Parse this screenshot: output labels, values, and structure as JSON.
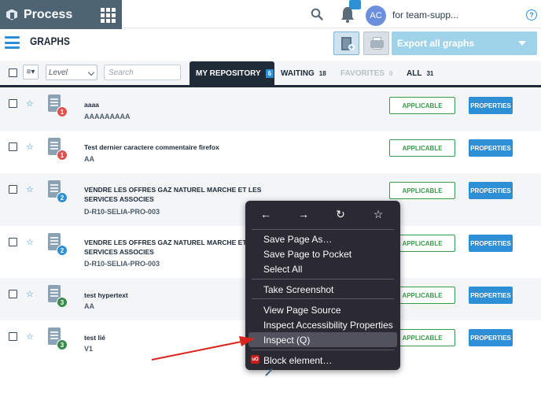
{
  "app": {
    "name": "Process",
    "team": "for team-supp...",
    "avatar_initials": "AC",
    "help": "?"
  },
  "page": {
    "title": "GRAPHS"
  },
  "actions": {
    "export_label": "Export all graphs"
  },
  "toolbar": {
    "level_label": "Level",
    "search_placeholder": "Search",
    "sort_glyph": "≡▾"
  },
  "tabs": [
    {
      "label": "MY REPOSITORY",
      "count": "6",
      "active": true
    },
    {
      "label": "WAITING",
      "count": "18"
    },
    {
      "label": "FAVORITES",
      "count": "0",
      "disabled": true
    },
    {
      "label": "ALL",
      "count": "31"
    }
  ],
  "rows": [
    {
      "title": "aaaa",
      "subtitle": "AAAAAAAAA",
      "level": "1",
      "level_color": "#e05252",
      "applicable": "APPLICABLE",
      "properties": "PROPERTIES"
    },
    {
      "title": "Test dernier caractere commentaire firefox",
      "subtitle": "AA",
      "level": "1",
      "level_color": "#e05252",
      "applicable": "APPLICABLE",
      "properties": "PROPERTIES"
    },
    {
      "title": "VENDRE LES OFFRES GAZ NATUREL MARCHE ET LES SERVICES ASSOCIES",
      "subtitle": "D-R10-SELIA-PRO-003",
      "level": "2",
      "level_color": "#2d8fd6",
      "applicable": "APPLICABLE",
      "properties": "PROPERTIES"
    },
    {
      "title": "VENDRE LES OFFRES GAZ NATUREL MARCHE ET LES SERVICES ASSOCIES",
      "subtitle": "D-R10-SELIA-PRO-003",
      "level": "2",
      "level_color": "#2d8fd6",
      "applicable": "APPLICABLE",
      "properties": "PROPERTIES"
    },
    {
      "title": "test hypertext",
      "subtitle": "AA",
      "level": "3",
      "level_color": "#3a8a4a",
      "applicable": "APPLICABLE",
      "properties": "PROPERTIES"
    },
    {
      "title": "test lié",
      "subtitle": "V1",
      "level": "3",
      "level_color": "#3a8a4a",
      "applicable": "APPLICABLE",
      "properties": "PROPERTIES"
    }
  ],
  "context_menu": {
    "nav": {
      "back": "←",
      "forward": "→",
      "reload": "↻",
      "bookmark": "☆"
    },
    "items": [
      {
        "label": "Save Page As…"
      },
      {
        "label": "Save Page to Pocket"
      },
      {
        "label": "Select All"
      },
      {
        "label": "Take Screenshot"
      },
      {
        "label": "View Page Source"
      },
      {
        "label": "Inspect Accessibility Properties"
      },
      {
        "label": "Inspect (Q)",
        "highlighted": true
      },
      {
        "label": "Block element…"
      }
    ],
    "ublock_badge": "uO"
  },
  "colors": {
    "accent": "#2d8fd6",
    "brand_bar": "#4f6473",
    "applicable": "#3a9a4a",
    "menu_bg": "#2b2a33",
    "annotation_arrow": "#d9251d"
  }
}
